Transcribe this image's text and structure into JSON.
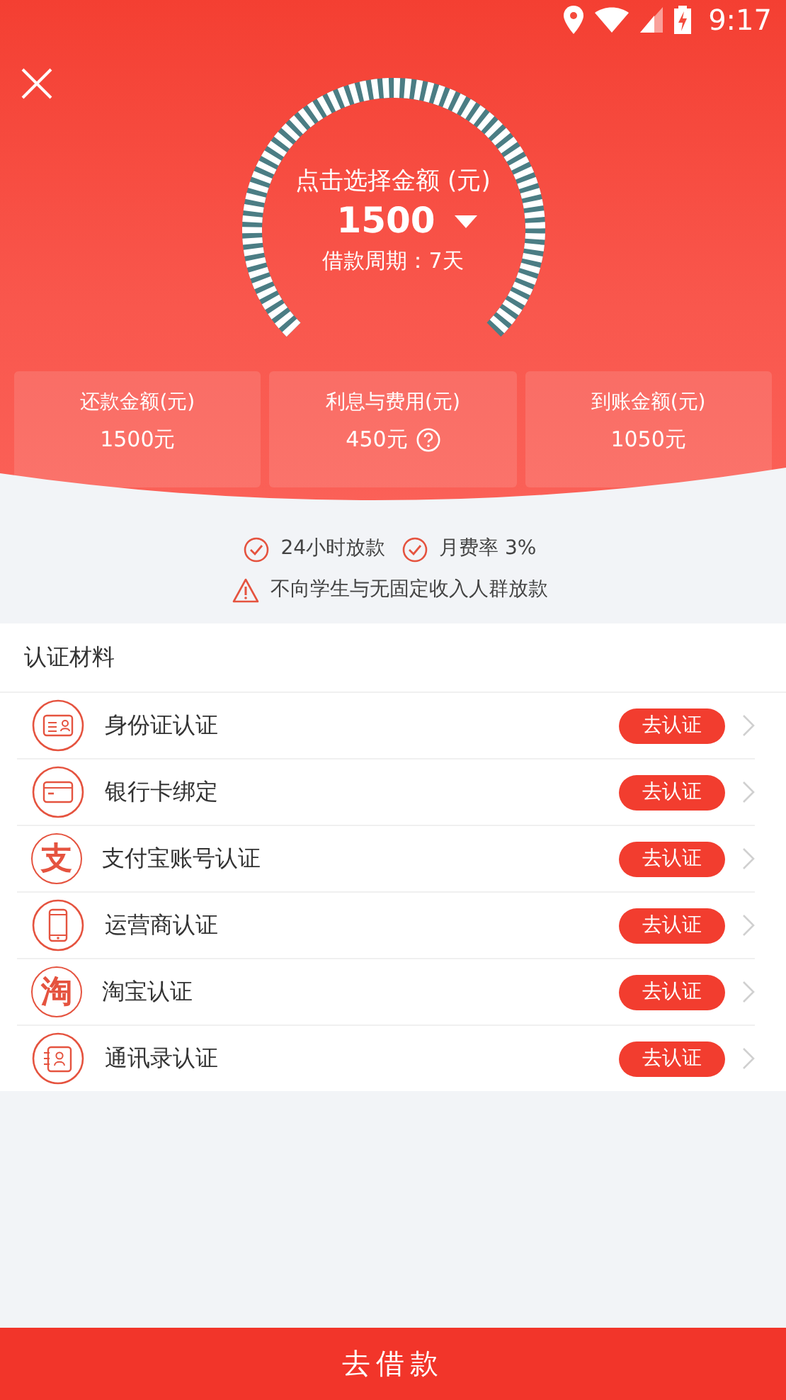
{
  "status_bar": {
    "time": "9:17"
  },
  "gauge": {
    "prompt": "点击选择金额 (元)",
    "amount": "1500",
    "period": "借款周期：7天"
  },
  "summary": [
    {
      "label": "还款金额(元)",
      "value": "1500元",
      "help": false
    },
    {
      "label": "利息与费用(元)",
      "value": "450元",
      "help": true
    },
    {
      "label": "到账金额(元)",
      "value": "1050元",
      "help": false
    }
  ],
  "notes": [
    [
      {
        "kind": "check",
        "text": "24小时放款"
      },
      {
        "kind": "check",
        "text": "月费率 3%"
      }
    ],
    [
      {
        "kind": "warning",
        "text": "不向学生与无固定收入人群放款"
      }
    ]
  ],
  "materials": {
    "title": "认证材料",
    "items": [
      {
        "kind": "id-card",
        "label": "身份证认证",
        "action": "去认证"
      },
      {
        "kind": "bank-card",
        "label": "银行卡绑定",
        "action": "去认证"
      },
      {
        "kind": "glyph",
        "glyph": "支",
        "label": "支付宝账号认证",
        "action": "去认证"
      },
      {
        "kind": "phone",
        "label": "运营商认证",
        "action": "去认证"
      },
      {
        "kind": "glyph",
        "glyph": "淘",
        "label": "淘宝认证",
        "action": "去认证"
      },
      {
        "kind": "contacts",
        "label": "通讯录认证",
        "action": "去认证"
      }
    ]
  },
  "submit": "去借款"
}
